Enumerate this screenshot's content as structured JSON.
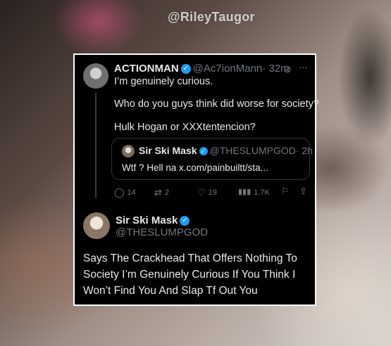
{
  "watermark": "@RileyTaugor",
  "original_tweet": {
    "name": "ACTIONMAN",
    "handle": "@Ac7ionMann",
    "time": "· 32m",
    "lines": [
      "I’m genuinely curious.",
      "Who do you guys think did worse for society?",
      "Hulk Hogan or XXXtentencion?"
    ],
    "quote": {
      "name": "Sir Ski Mask",
      "handle": "@THESLUMPGOD",
      "time": "· 2h",
      "text": "Wtf ? Hell na x.com/painbuiltt/sta..."
    },
    "actions": {
      "replies": "14",
      "reposts": "2",
      "likes": "19",
      "views": "1.7K"
    }
  },
  "reply_tweet": {
    "name": "Sir Ski Mask",
    "handle": "@THESLUMPGOD",
    "lines": [
      "Says The Crackhead That Offers Nothing To",
      "Society I’m Genuinely Curious If You Think I",
      "Won’t Find You And Slap Tf Out You"
    ]
  },
  "icons": {
    "verified": "verified-badge-icon",
    "grok": "grok-icon",
    "more": "more-icon",
    "reply": "reply-icon",
    "repost": "repost-icon",
    "like": "like-icon",
    "views": "views-icon",
    "bookmark": "bookmark-icon",
    "share": "share-icon"
  },
  "colors": {
    "card_bg": "#000000",
    "text": "#e7e9ea",
    "muted": "#71767b",
    "verified": "#1d9bf0"
  }
}
